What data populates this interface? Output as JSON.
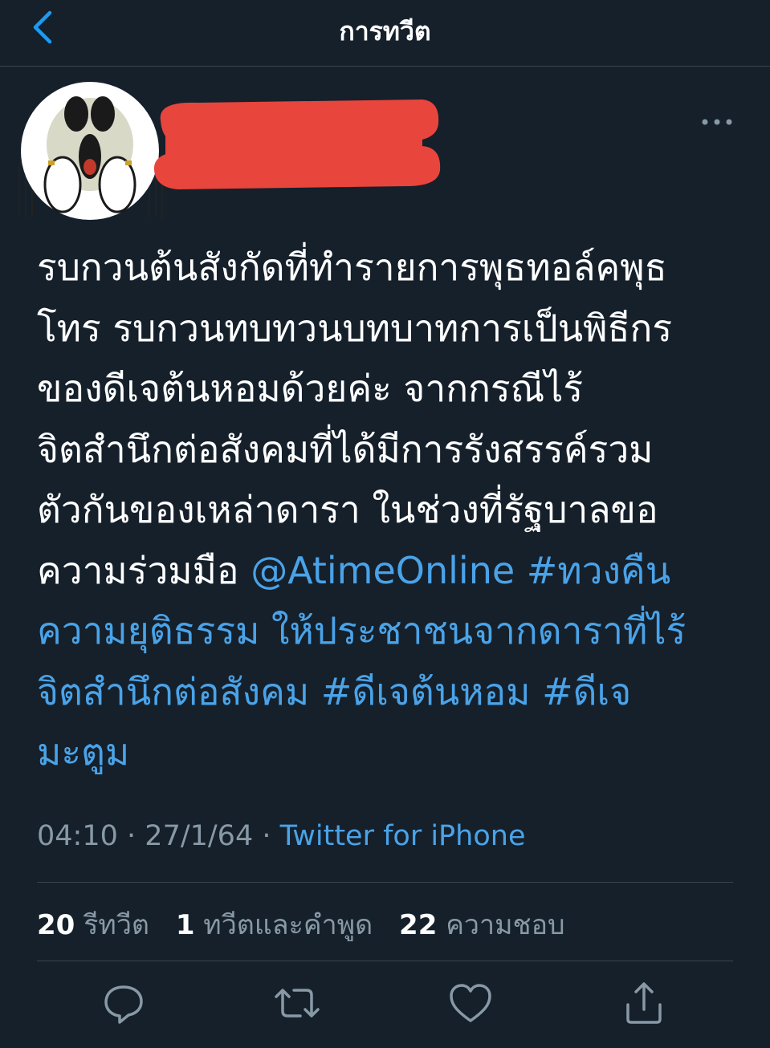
{
  "header": {
    "title": "การทวีต",
    "back_icon": "chevron-left-icon"
  },
  "author": {
    "avatar_icon": "shocked-face-avatar",
    "name_redacted": true
  },
  "tweet": {
    "lines": [
      "รบกวนต้นสังกัดที่ทำรายการพุธทอล์คพุธ",
      "โทร รบกวนทบทวนบทบาทการเป็นพิธีกร",
      "ของดีเจต้นหอมด้วยค่ะ จากกรณีไร้",
      "จิตสำนึกต่อสังคมที่ได้มีการรังสรรค์รวม",
      "ตัวกันของเหล่าดารา ในช่วงที่รัฐบาลขอ"
    ],
    "line6_plain": "ความร่วมมือ ",
    "line6_link": "@AtimeOnline #ทวงคืน",
    "link_lines": [
      "ความยุติธรรม ให้ประชาชนจากดาราที่ไร้",
      "จิตสำนึกต่อสังคม #ดีเจต้นหอม #ดีเจ",
      "มะตูม"
    ]
  },
  "meta": {
    "time": "04:10",
    "date": "27/1/64",
    "separator": "·",
    "source": "Twitter for iPhone"
  },
  "stats": {
    "retweets": "20",
    "retweets_label": "รีทวีต",
    "quotes": "1",
    "quotes_label": "ทวีตและคำพูด",
    "likes": "22",
    "likes_label": "ความชอบ"
  },
  "colors": {
    "background": "#15202b",
    "link": "#4aa3e8",
    "muted": "#8899a6",
    "divider": "#38444d",
    "redaction": "#e8453c"
  }
}
